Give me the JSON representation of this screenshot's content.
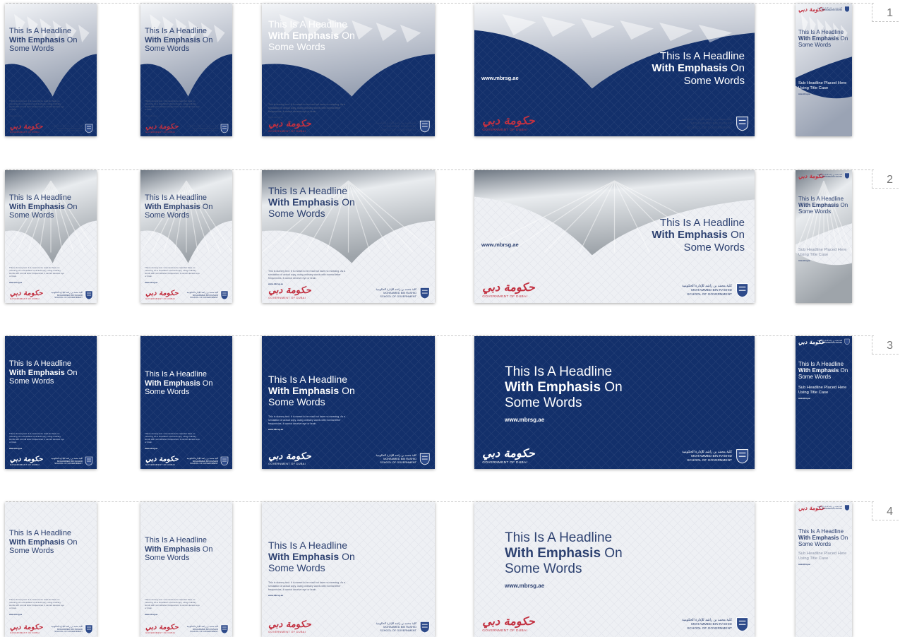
{
  "headline": {
    "line1": "This Is A Headline",
    "line2_bold": "With Emphasis",
    "line2_rest": " On",
    "line3": "Some Words"
  },
  "body_text": "This is dummy text. It is meant to be read but have no meaning. As a simulation of actual copy, using ordinary words with normal letter frequencies, it cannot deceive eye or brain.",
  "url_short": "www.mbrsg.ae",
  "sub_headline": "Sub Headline Placed Here Using Title Case",
  "logo": {
    "arabic": "حكومة دبي",
    "caption": "GOVERNMENT OF DUBAI"
  },
  "school": {
    "arabic": "كلية محمد بن راشد للإدارة الحكومية",
    "english_line1": "MOHAMMED BIN RASHID",
    "english_line2": "SCHOOL OF GOVERNMENT"
  },
  "row_numbers": [
    "1",
    "2",
    "3",
    "4"
  ],
  "colors": {
    "navy": "#13306b",
    "navy_dark": "#0f275a",
    "light_gray": "#eef0f4",
    "red": "#c23141",
    "text_navy": "#2d4170"
  },
  "styles": [
    "geometric-sky-arc",
    "pier-photo-arc",
    "solid-navy-pattern",
    "light-gray-pattern"
  ]
}
